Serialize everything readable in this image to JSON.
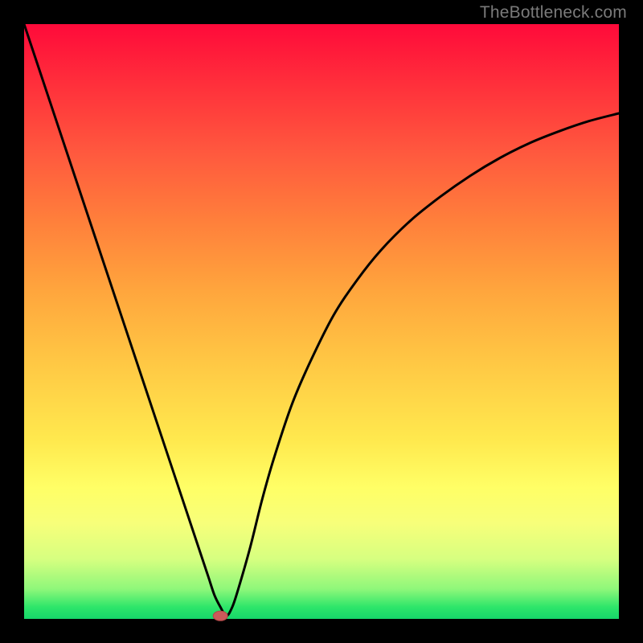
{
  "watermark": "TheBottleneck.com",
  "chart_data": {
    "type": "line",
    "title": "",
    "xlabel": "",
    "ylabel": "",
    "xlim": [
      0,
      100
    ],
    "ylim": [
      0,
      100
    ],
    "series": [
      {
        "name": "curve",
        "x": [
          0,
          4,
          8,
          12,
          16,
          20,
          24,
          28,
          30,
          31,
          32,
          33,
          34,
          35,
          36,
          38,
          40,
          42,
          45,
          48,
          52,
          56,
          60,
          65,
          70,
          75,
          80,
          85,
          90,
          95,
          100
        ],
        "values": [
          100,
          88,
          76,
          64,
          52,
          40,
          28,
          16,
          10,
          7,
          4,
          2,
          0.5,
          2,
          5,
          12,
          20,
          27,
          36,
          43,
          51,
          57,
          62,
          67,
          71,
          74.5,
          77.5,
          80,
          82,
          83.7,
          85
        ]
      }
    ],
    "marker": {
      "x": 33,
      "y": 0.5
    },
    "background_gradient": {
      "type": "vertical",
      "stops": [
        {
          "pos": 0,
          "color": "#ff0a3a"
        },
        {
          "pos": 50,
          "color": "#ffc844"
        },
        {
          "pos": 80,
          "color": "#ffff66"
        },
        {
          "pos": 100,
          "color": "#16d66a"
        }
      ]
    }
  }
}
